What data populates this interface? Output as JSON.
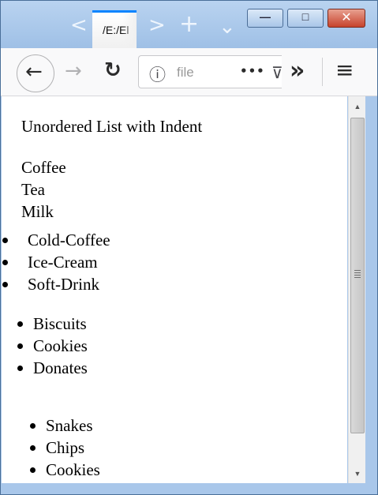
{
  "browser": {
    "tab_title": "/E:/El",
    "url_text": "file",
    "nav": {
      "tab_scroll_left": "<",
      "tab_scroll_right": ">",
      "new_tab": "+",
      "tab_list": "⌄"
    },
    "toolbar": {
      "back": "←",
      "forward": "→",
      "reload": "↻",
      "info": "ⓘ",
      "page_actions": "•••",
      "pocket": "⊽",
      "overflow": "»",
      "menu": "≡"
    },
    "window_buttons": {
      "minimize": "—",
      "maximize": "□",
      "close": "✕"
    }
  },
  "page": {
    "heading": "Unordered List with Indent",
    "plain_list": [
      "Coffee",
      "Tea",
      "Milk"
    ],
    "list_no_indent": [
      "Cold-Coffee",
      "Ice-Cream",
      "Soft-Drink"
    ],
    "list_default": [
      "Biscuits",
      "Cookies",
      "Donates"
    ],
    "list_indented": [
      "Snakes",
      "Chips",
      "Cookies"
    ]
  }
}
